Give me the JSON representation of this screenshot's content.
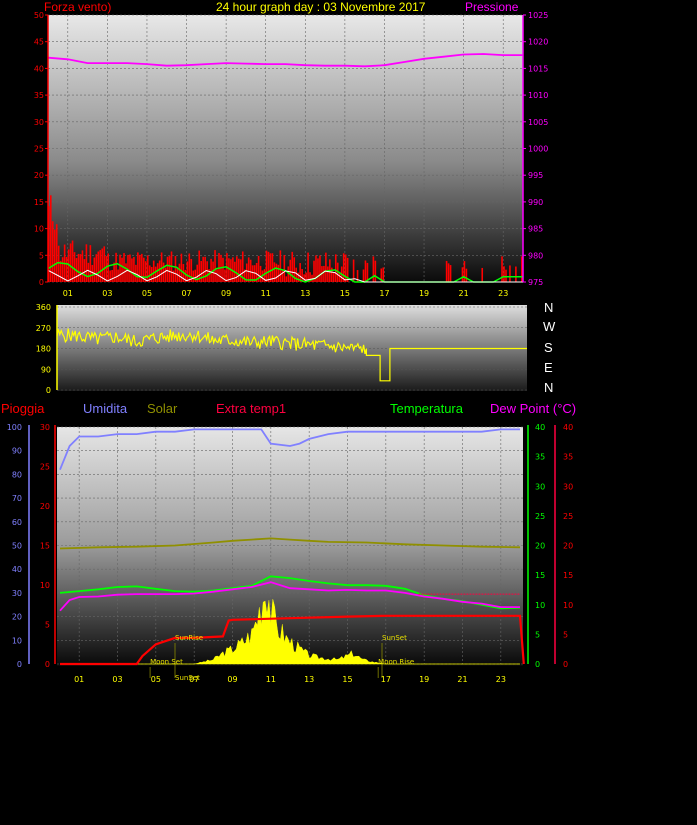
{
  "header": {
    "left_label": "Forza vento)",
    "title": "24 hour graph day : 03 Novembre 2017",
    "right_label": "Pressione"
  },
  "labels": {
    "pioggia": "Pioggia",
    "umidita": "Umidita",
    "solar": "Solar",
    "extra_temp": "Extra temp1",
    "temperatura": "Temperatura",
    "dew_point": "Dew Point (°C)"
  },
  "compass": [
    "N",
    "W",
    "S",
    "E",
    "N"
  ],
  "markers": {
    "sunrise": "SunRise",
    "sunset": "SunSet",
    "moonset": "Moon Set",
    "moonrise": "Moon Rise"
  },
  "colors": {
    "wind": "#ff0000",
    "gust": "#ffffff",
    "wind_avg": "#00ff00",
    "pressure": "#ff00ff",
    "direction": "#ffff00",
    "humidity": "#8080ff",
    "solar": "#909000",
    "extra": "#ff0040",
    "temperature": "#00ff00",
    "dewpoint": "#ff00ff",
    "rain": "#ff0000",
    "radiation": "#ffff00"
  },
  "chart_data": [
    {
      "type": "line",
      "title": "24 hour graph day : 03 Novembre 2017",
      "x_ticks": [
        "01",
        "03",
        "05",
        "07",
        "09",
        "11",
        "13",
        "15",
        "17",
        "19",
        "21",
        "23"
      ],
      "x_range_hours": [
        0,
        24
      ],
      "y_left_label": "Forza vento)",
      "y_left_ticks": [
        0,
        5,
        10,
        15,
        20,
        25,
        30,
        35,
        40,
        45,
        50
      ],
      "y_left_range": [
        0,
        50
      ],
      "y_right_label": "Pressione",
      "y_right_ticks": [
        975,
        980,
        985,
        990,
        995,
        1000,
        1005,
        1010,
        1015,
        1020,
        1025
      ],
      "y_right_range": [
        975,
        1025
      ],
      "series": [
        {
          "name": "Pressione",
          "axis": "right",
          "points": [
            [
              0,
              1017.0
            ],
            [
              1,
              1016.7
            ],
            [
              2,
              1016.0
            ],
            [
              3,
              1016.0
            ],
            [
              4,
              1016.0
            ],
            [
              5,
              1015.8
            ],
            [
              6,
              1015.5
            ],
            [
              7,
              1015.6
            ],
            [
              8,
              1015.8
            ],
            [
              9,
              1016.0
            ],
            [
              10,
              1015.9
            ],
            [
              11,
              1015.8
            ],
            [
              12,
              1015.8
            ],
            [
              13,
              1015.6
            ],
            [
              14,
              1015.5
            ],
            [
              15,
              1015.5
            ],
            [
              16,
              1015.4
            ],
            [
              17,
              1015.6
            ],
            [
              18,
              1016.2
            ],
            [
              19,
              1016.8
            ],
            [
              20,
              1017.2
            ],
            [
              21,
              1017.6
            ],
            [
              22,
              1017.7
            ],
            [
              23,
              1017.5
            ],
            [
              24,
              1017.5
            ]
          ]
        }
      ]
    },
    {
      "type": "line",
      "x_ticks": [
        "01",
        "03",
        "05",
        "07",
        "09",
        "11",
        "13",
        "15",
        "17",
        "19",
        "21",
        "23"
      ],
      "y_ticks": [
        0,
        90,
        180,
        270,
        360
      ],
      "y_range": [
        0,
        360
      ],
      "series": [
        {
          "name": "direction",
          "points": [
            [
              0,
              240
            ],
            [
              1,
              235
            ],
            [
              2,
              220
            ],
            [
              3,
              230
            ],
            [
              4,
              210
            ],
            [
              5,
              225
            ],
            [
              6,
              235
            ],
            [
              7,
              240
            ],
            [
              8,
              215
            ],
            [
              9,
              215
            ],
            [
              10,
              205
            ],
            [
              11,
              210
            ],
            [
              12,
              200
            ],
            [
              13,
              195
            ],
            [
              14,
              190
            ],
            [
              15,
              180
            ],
            [
              15.8,
              180
            ],
            [
              15.8,
              150
            ],
            [
              16.5,
              150
            ],
            [
              16.5,
              40
            ],
            [
              17,
              40
            ],
            [
              17,
              180
            ],
            [
              24,
              180
            ]
          ]
        }
      ]
    },
    {
      "type": "line",
      "x_ticks": [
        "01",
        "03",
        "05",
        "07",
        "09",
        "11",
        "13",
        "15",
        "17",
        "19",
        "21",
        "23"
      ],
      "x_range_hours": [
        0,
        24
      ],
      "axes": {
        "umidita": {
          "ticks": [
            0,
            10,
            20,
            30,
            40,
            50,
            60,
            70,
            80,
            90,
            100
          ],
          "range": [
            0,
            100
          ]
        },
        "pioggia": {
          "ticks": [
            0,
            5,
            10,
            15,
            20,
            25,
            30
          ],
          "range": [
            0,
            30
          ]
        },
        "temperatura": {
          "ticks": [
            0,
            5,
            10,
            15,
            20,
            25,
            30,
            35,
            40
          ],
          "range": [
            0,
            40
          ]
        },
        "dew_point": {
          "ticks": [
            0,
            5,
            10,
            15,
            20,
            25,
            30,
            35,
            40
          ],
          "range": [
            0,
            40
          ]
        }
      },
      "series": [
        {
          "name": "Umidita",
          "axis": "umidita",
          "points": [
            [
              0,
              82
            ],
            [
              0.5,
              92
            ],
            [
              1,
              96
            ],
            [
              2,
              96
            ],
            [
              3,
              97
            ],
            [
              4,
              97
            ],
            [
              5,
              98
            ],
            [
              6,
              98
            ],
            [
              7,
              99
            ],
            [
              8,
              99
            ],
            [
              9,
              99
            ],
            [
              10,
              99
            ],
            [
              10.5,
              99
            ],
            [
              11,
              93
            ],
            [
              12,
              92
            ],
            [
              12.5,
              93
            ],
            [
              13,
              95
            ],
            [
              14,
              97
            ],
            [
              15,
              98
            ],
            [
              16,
              98
            ],
            [
              17,
              98
            ],
            [
              18,
              98
            ],
            [
              19,
              98
            ],
            [
              20,
              98
            ],
            [
              21,
              98
            ],
            [
              22,
              98
            ],
            [
              23,
              99
            ],
            [
              24,
              99
            ]
          ]
        },
        {
          "name": "Solar",
          "axis": "temperatura",
          "points": [
            [
              0,
              19.5
            ],
            [
              2,
              19.7
            ],
            [
              4,
              19.8
            ],
            [
              6,
              20.0
            ],
            [
              8,
              20.5
            ],
            [
              9,
              20.8
            ],
            [
              10,
              21.0
            ],
            [
              11,
              21.2
            ],
            [
              12,
              21.0
            ],
            [
              13,
              20.8
            ],
            [
              14,
              20.6
            ],
            [
              16,
              20.5
            ],
            [
              18,
              20.2
            ],
            [
              20,
              20.0
            ],
            [
              22,
              19.8
            ],
            [
              24,
              19.7
            ]
          ]
        },
        {
          "name": "Temperatura",
          "axis": "temperatura",
          "points": [
            [
              0,
              12.0
            ],
            [
              1,
              12.3
            ],
            [
              2,
              12.6
            ],
            [
              3,
              13.0
            ],
            [
              4,
              13.1
            ],
            [
              5,
              12.7
            ],
            [
              6,
              12.3
            ],
            [
              7,
              12.2
            ],
            [
              8,
              12.4
            ],
            [
              9,
              12.8
            ],
            [
              10,
              13.2
            ],
            [
              11,
              14.8
            ],
            [
              12,
              14.5
            ],
            [
              13,
              14.0
            ],
            [
              14,
              13.6
            ],
            [
              15,
              13.3
            ],
            [
              16,
              13.3
            ],
            [
              17,
              13.2
            ],
            [
              18,
              12.7
            ],
            [
              19,
              11.6
            ],
            [
              20,
              11.0
            ],
            [
              21,
              10.6
            ],
            [
              22,
              10.0
            ],
            [
              23,
              9.4
            ],
            [
              24,
              9.5
            ]
          ]
        },
        {
          "name": "Dew Point (°C)",
          "axis": "dew_point",
          "points": [
            [
              0,
              9.0
            ],
            [
              0.5,
              10.8
            ],
            [
              1,
              11.3
            ],
            [
              2,
              11.4
            ],
            [
              3,
              11.7
            ],
            [
              4,
              11.8
            ],
            [
              5,
              11.8
            ],
            [
              6,
              11.8
            ],
            [
              7,
              11.9
            ],
            [
              8,
              12.2
            ],
            [
              9,
              12.6
            ],
            [
              10,
              13.0
            ],
            [
              11,
              13.8
            ],
            [
              12,
              12.8
            ],
            [
              13,
              12.6
            ],
            [
              14,
              12.4
            ],
            [
              15,
              12.5
            ],
            [
              16,
              12.4
            ],
            [
              17,
              12.4
            ],
            [
              18,
              12.0
            ],
            [
              19,
              11.4
            ],
            [
              20,
              11.0
            ],
            [
              21,
              10.5
            ],
            [
              22,
              10.2
            ],
            [
              23,
              9.6
            ],
            [
              24,
              9.6
            ]
          ]
        },
        {
          "name": "Pioggia",
          "axis": "pioggia",
          "points": [
            [
              0,
              0
            ],
            [
              4,
              0
            ],
            [
              4.3,
              1.0
            ],
            [
              5,
              2.5
            ],
            [
              6,
              3.3
            ],
            [
              7,
              3.3
            ],
            [
              8.5,
              3.5
            ],
            [
              8.8,
              5.5
            ],
            [
              9,
              5.6
            ],
            [
              12,
              5.8
            ],
            [
              15,
              6.0
            ],
            [
              17,
              6.1
            ],
            [
              24,
              6.1
            ],
            [
              24.2,
              0
            ]
          ]
        },
        {
          "name": "radiation",
          "axis": "umidita",
          "points": [
            [
              0,
              0
            ],
            [
              7,
              0
            ],
            [
              7.5,
              1
            ],
            [
              8,
              2
            ],
            [
              8.5,
              5
            ],
            [
              9,
              7
            ],
            [
              9.5,
              10
            ],
            [
              10,
              14
            ],
            [
              10.3,
              22
            ],
            [
              10.6,
              32
            ],
            [
              10.8,
              37
            ],
            [
              11,
              25
            ],
            [
              11.3,
              18
            ],
            [
              11.8,
              12
            ],
            [
              12.5,
              7
            ],
            [
              13,
              4
            ],
            [
              13.5,
              3
            ],
            [
              14.5,
              2
            ],
            [
              15.3,
              5
            ],
            [
              15.8,
              2
            ],
            [
              16.3,
              1
            ],
            [
              17,
              0
            ],
            [
              24,
              0
            ]
          ]
        }
      ]
    }
  ]
}
